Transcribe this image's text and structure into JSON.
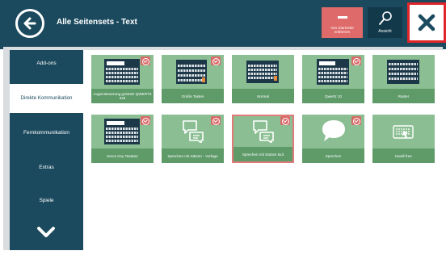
{
  "header": {
    "title": "Alle Seitensets - Text",
    "remove_label": "Von Startseite entfernen",
    "view_label": "Ansicht"
  },
  "sidebar": {
    "items": [
      {
        "label": "Add-ons"
      },
      {
        "label": "Direkte Kommunikation",
        "active": true
      },
      {
        "label": "Fernkommunikation"
      },
      {
        "label": "Extras"
      },
      {
        "label": "Spiele"
      }
    ]
  },
  "tiles": [
    {
      "label": "Augensteuerung gestützt QWERTZ 6x8",
      "icon": "keyboard-icon",
      "checked": true
    },
    {
      "label": "Große Tasten",
      "icon": "keyboard-icon",
      "checked": true
    },
    {
      "label": "Normal",
      "icon": "keyboard-icon",
      "checked": false
    },
    {
      "label": "Qwertz 10",
      "icon": "keyboard-icon",
      "checked": true
    },
    {
      "label": "Raster",
      "icon": "keyboard-icon",
      "checked": false
    },
    {
      "label": "Servo Key Tastatur",
      "icon": "keyboard-icon",
      "checked": true
    },
    {
      "label": "Sprechen mit Sätzen - Vorlage",
      "icon": "speech-bubbles-icon",
      "checked": true
    },
    {
      "label": "Sprechen mit Sätzen 5x3",
      "icon": "speech-bubbles-icon",
      "checked": true,
      "selected": true
    },
    {
      "label": "Sprechen",
      "icon": "speech-bubble-icon",
      "checked": true
    },
    {
      "label": "Dwell-free",
      "icon": "swipe-keyboard-icon",
      "checked": false
    }
  ],
  "colors": {
    "header_bg": "#1b4a5e",
    "tile_bg": "#8bbf93",
    "tile_label_bg": "#5e9b69",
    "badge": "#d86b6a",
    "close_border": "#e0262a"
  }
}
